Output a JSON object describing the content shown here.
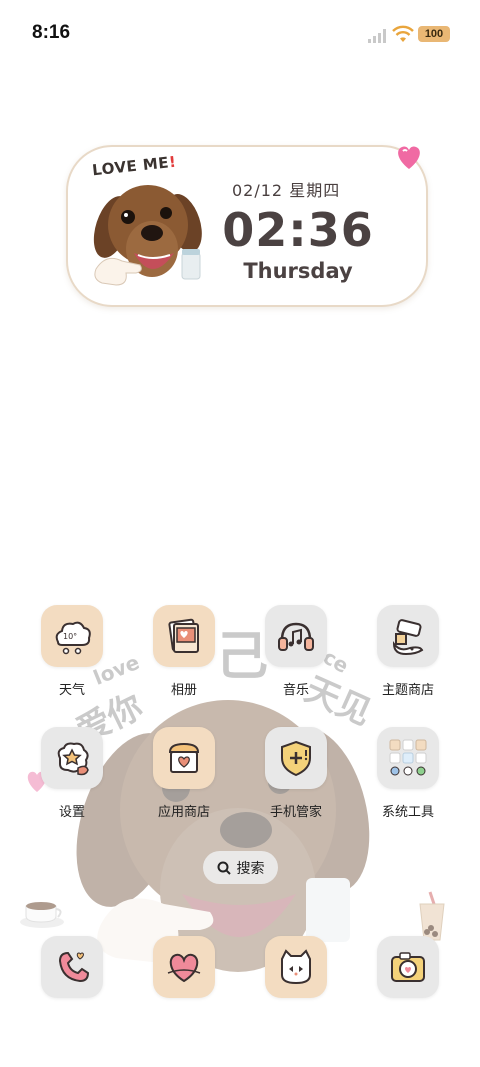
{
  "status_bar": {
    "time": "8:16",
    "battery": "100",
    "icons": [
      "signal-icon",
      "wifi-icon",
      "battery-icon"
    ]
  },
  "widget": {
    "sticker_text": "LOVE ME",
    "sticker_bang": "!",
    "date": "02/12 星期四",
    "time": "02:36",
    "weekday": "Thursday"
  },
  "watermark": {
    "text": "爱你",
    "sub": "love",
    "mid": "己",
    "tail": "天见",
    "tail_sub": "ce"
  },
  "apps": [
    {
      "id": "weather",
      "label": "天气",
      "icon": "weather-cloud-icon",
      "bg": "#f3dcc1",
      "detail": "10°"
    },
    {
      "id": "gallery",
      "label": "相册",
      "icon": "photo-album-icon",
      "bg": "#f3dcc1"
    },
    {
      "id": "music",
      "label": "音乐",
      "icon": "music-note-icon",
      "bg": "#e8e8e8"
    },
    {
      "id": "theme-store",
      "label": "主题商店",
      "icon": "paint-brush-icon",
      "bg": "#e8e8e8"
    },
    {
      "id": "settings",
      "label": "设置",
      "icon": "settings-star-icon",
      "bg": "#e8e8e8"
    },
    {
      "id": "app-store",
      "label": "应用商店",
      "icon": "store-heart-icon",
      "bg": "#f3dcc1"
    },
    {
      "id": "phone-manager",
      "label": "手机管家",
      "icon": "shield-plus-icon",
      "bg": "#e8e8e8"
    },
    {
      "id": "system-tools",
      "label": "系统工具",
      "icon": "folder-grid-icon",
      "bg": "#e8e8e8"
    }
  ],
  "search": {
    "label": "搜索"
  },
  "dock": [
    {
      "id": "dock-phone",
      "icon": "phone-heart-icon",
      "bg": "#e8e8e8"
    },
    {
      "id": "dock-messages",
      "icon": "heart-chat-icon",
      "bg": "#f3dcc1"
    },
    {
      "id": "dock-browser",
      "icon": "cat-face-icon",
      "bg": "#f3dcc1"
    },
    {
      "id": "dock-camera",
      "icon": "camera-heart-icon",
      "bg": "#e8e8e8"
    }
  ],
  "colors": {
    "peach": "#f3dcc1",
    "gray": "#e8e8e8",
    "battery": "#e9b774",
    "text_dark": "#4b4242"
  }
}
